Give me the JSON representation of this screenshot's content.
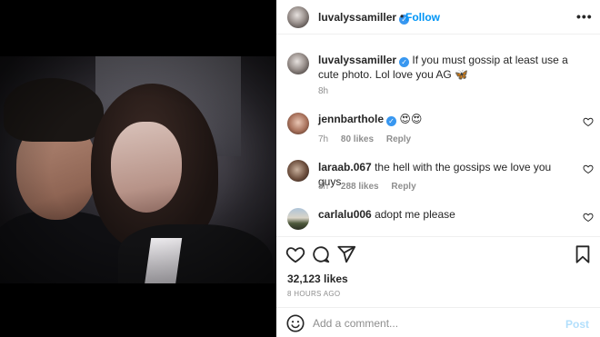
{
  "post": {
    "owner": "luvalyssamiller",
    "verified": true,
    "follow_label": "Follow",
    "more_label": "•••"
  },
  "caption": {
    "username": "luvalyssamiller",
    "text": "If you must gossip at least use a cute photo. Lol love you AG 🦋",
    "time": "8h"
  },
  "comments": [
    {
      "username": "jennbarthole",
      "verified": true,
      "text": "😍😍",
      "time": "7h",
      "likes": "80 likes",
      "reply": "Reply"
    },
    {
      "username": "laraab.067",
      "verified": false,
      "text": "the hell with the gossips we love you guys",
      "time": "8h",
      "likes": "288 likes",
      "reply": "Reply"
    },
    {
      "username": "carlalu006",
      "verified": false,
      "text": "adopt me please",
      "time": "",
      "likes": "",
      "reply": ""
    }
  ],
  "stats": {
    "likes": "32,123 likes",
    "date": "8 HOURS AGO"
  },
  "comment_box": {
    "placeholder": "Add a comment...",
    "post_label": "Post"
  },
  "icons": {
    "like": "heart-icon",
    "comment": "comment-icon",
    "share": "paper-plane-icon",
    "save": "bookmark-icon",
    "emoji": "emoji-icon",
    "verified": "verified-badge-icon"
  },
  "colors": {
    "accent": "#0095f6",
    "verified": "#3897f0",
    "muted": "#8e8e8e",
    "post_disabled": "#b2dffc"
  }
}
